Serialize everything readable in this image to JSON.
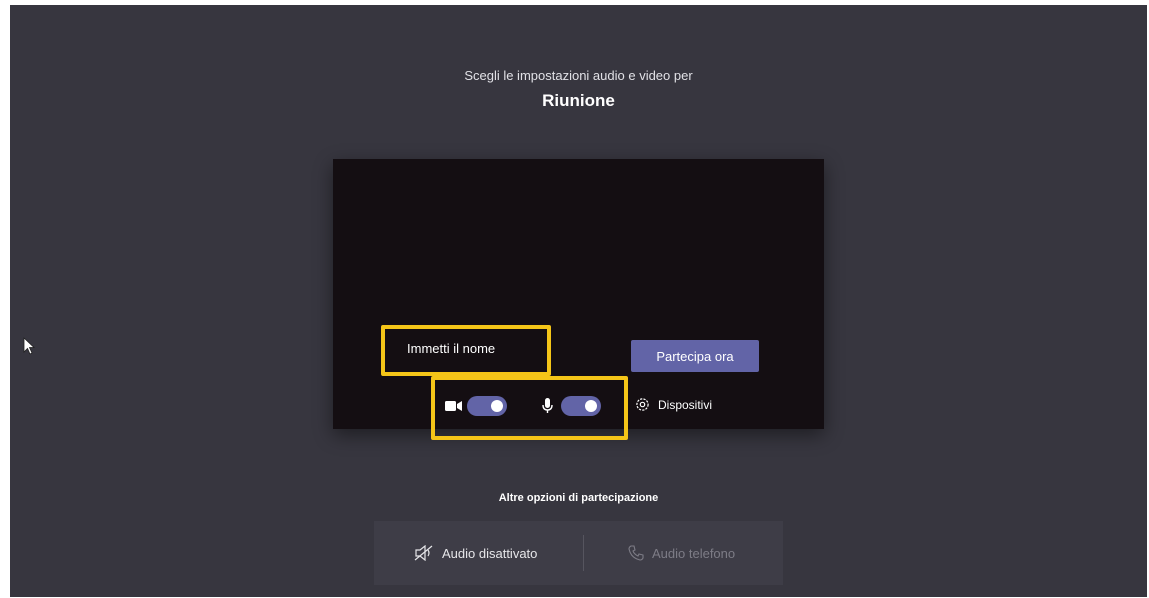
{
  "header": {
    "subtitle": "Scegli le impostazioni audio e video per",
    "title": "Riunione"
  },
  "prejoin": {
    "name_placeholder": "Immetti il nome",
    "name_value": "",
    "join_label": "Partecipa ora",
    "camera_icon": "video-camera-icon",
    "camera_on": true,
    "mic_icon": "microphone-icon",
    "mic_on": true,
    "devices_icon": "gear-icon",
    "devices_label": "Dispositivi"
  },
  "other_options": {
    "title": "Altre opzioni di partecipazione",
    "audio_off_icon": "speaker-muted-icon",
    "audio_off_label": "Audio disattivato",
    "phone_icon": "phone-icon",
    "phone_label": "Audio telefono"
  },
  "colors": {
    "background": "#37363f",
    "accent": "#6264a7",
    "highlight": "#f5c518",
    "preview": "#140e12"
  }
}
